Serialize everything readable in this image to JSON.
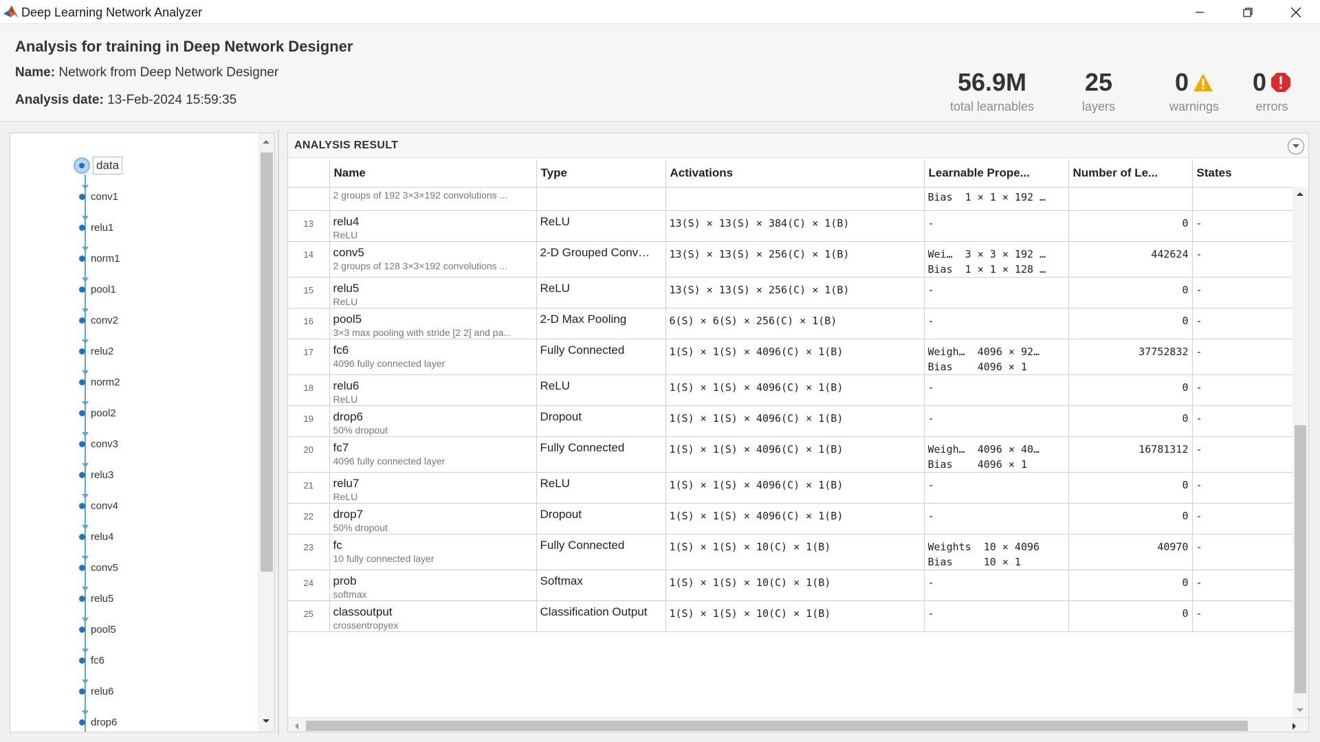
{
  "window": {
    "title": "Deep Learning Network Analyzer"
  },
  "header": {
    "heading": "Analysis for training in Deep Network Designer",
    "name_label": "Name:",
    "name_value": "Network from Deep Network Designer",
    "date_label": "Analysis date:",
    "date_value": "13-Feb-2024 15:59:35",
    "stats": [
      {
        "value": "56.9M",
        "label": "total learnables"
      },
      {
        "value": "25",
        "label": "layers"
      },
      {
        "value": "0",
        "label": "warnings",
        "icon": "warning-icon"
      },
      {
        "value": "0",
        "label": "errors",
        "icon": "error-icon"
      }
    ]
  },
  "graph": {
    "selected": "data",
    "nodes": [
      "data",
      "conv1",
      "relu1",
      "norm1",
      "pool1",
      "conv2",
      "relu2",
      "norm2",
      "pool2",
      "conv3",
      "relu3",
      "conv4",
      "relu4",
      "conv5",
      "relu5",
      "pool5",
      "fc6",
      "relu6",
      "drop6"
    ]
  },
  "result": {
    "title": "ANALYSIS RESULT",
    "columns": [
      "",
      "Name",
      "Type",
      "Activations",
      "Learnable Prope...",
      "Number of Le...",
      "States"
    ],
    "partial_row": {
      "desc": "2 groups of 192 3×3×192 convolutions ...",
      "learn": [
        "Bias  1 × 1 × 192 …"
      ]
    },
    "rows": [
      {
        "idx": "13",
        "name": "relu4",
        "desc": "ReLU",
        "type": "ReLU",
        "act": "13(S) × 13(S) × 384(C) × 1(B)",
        "learn": [
          "-"
        ],
        "count": "0",
        "states": "-"
      },
      {
        "idx": "14",
        "name": "conv5",
        "desc": "2 groups of 128 3×3×192 convolutions ...",
        "type": "2-D Grouped Conv…",
        "act": "13(S) × 13(S) × 256(C) × 1(B)",
        "learn": [
          "Wei…  3 × 3 × 192 …",
          "Bias  1 × 1 × 128 …"
        ],
        "count": "442624",
        "states": "-"
      },
      {
        "idx": "15",
        "name": "relu5",
        "desc": "ReLU",
        "type": "ReLU",
        "act": "13(S) × 13(S) × 256(C) × 1(B)",
        "learn": [
          "-"
        ],
        "count": "0",
        "states": "-"
      },
      {
        "idx": "16",
        "name": "pool5",
        "desc": "3×3 max pooling with stride [2 2] and pa...",
        "type": "2-D Max Pooling",
        "act": "6(S) × 6(S) × 256(C) × 1(B)",
        "learn": [
          "-"
        ],
        "count": "0",
        "states": "-"
      },
      {
        "idx": "17",
        "name": "fc6",
        "desc": "4096 fully connected layer",
        "type": "Fully Connected",
        "act": "1(S) × 1(S) × 4096(C) × 1(B)",
        "learn": [
          "Weigh…  4096 × 92…",
          "Bias    4096 × 1"
        ],
        "count": "37752832",
        "states": "-"
      },
      {
        "idx": "18",
        "name": "relu6",
        "desc": "ReLU",
        "type": "ReLU",
        "act": "1(S) × 1(S) × 4096(C) × 1(B)",
        "learn": [
          "-"
        ],
        "count": "0",
        "states": "-"
      },
      {
        "idx": "19",
        "name": "drop6",
        "desc": "50% dropout",
        "type": "Dropout",
        "act": "1(S) × 1(S) × 4096(C) × 1(B)",
        "learn": [
          "-"
        ],
        "count": "0",
        "states": "-"
      },
      {
        "idx": "20",
        "name": "fc7",
        "desc": "4096 fully connected layer",
        "type": "Fully Connected",
        "act": "1(S) × 1(S) × 4096(C) × 1(B)",
        "learn": [
          "Weigh…  4096 × 40…",
          "Bias    4096 × 1"
        ],
        "count": "16781312",
        "states": "-"
      },
      {
        "idx": "21",
        "name": "relu7",
        "desc": "ReLU",
        "type": "ReLU",
        "act": "1(S) × 1(S) × 4096(C) × 1(B)",
        "learn": [
          "-"
        ],
        "count": "0",
        "states": "-"
      },
      {
        "idx": "22",
        "name": "drop7",
        "desc": "50% dropout",
        "type": "Dropout",
        "act": "1(S) × 1(S) × 4096(C) × 1(B)",
        "learn": [
          "-"
        ],
        "count": "0",
        "states": "-"
      },
      {
        "idx": "23",
        "name": "fc",
        "desc": "10 fully connected layer",
        "type": "Fully Connected",
        "act": "1(S) × 1(S) × 10(C) × 1(B)",
        "learn": [
          "Weights  10 × 4096",
          "Bias     10 × 1"
        ],
        "count": "40970",
        "states": "-"
      },
      {
        "idx": "24",
        "name": "prob",
        "desc": "softmax",
        "type": "Softmax",
        "act": "1(S) × 1(S) × 10(C) × 1(B)",
        "learn": [
          "-"
        ],
        "count": "0",
        "states": "-"
      },
      {
        "idx": "25",
        "name": "classoutput",
        "desc": "crossentropyex",
        "type": "Classification Output",
        "act": "1(S) × 1(S) × 10(C) × 1(B)",
        "learn": [
          "-"
        ],
        "count": "0",
        "states": "-"
      }
    ]
  },
  "colors": {
    "accent": "#1e73be",
    "warning": "#f2a900",
    "error": "#d92c2c",
    "matlab_orange": "#e16737"
  }
}
